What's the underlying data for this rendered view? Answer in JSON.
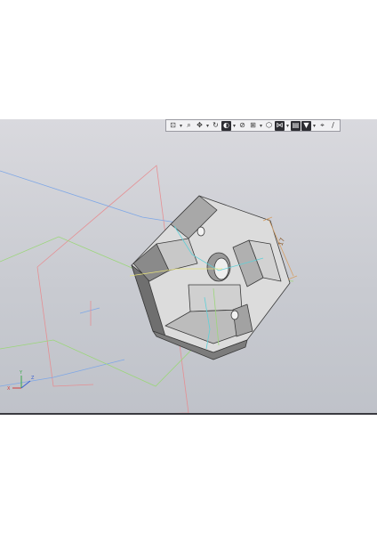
{
  "toolbar": {
    "buttons": [
      {
        "name": "view-orientation-button",
        "glyph": "⊡",
        "dark": false
      },
      {
        "name": "zoom-window-button",
        "glyph": "⌕",
        "dark": false
      },
      {
        "name": "pan-button",
        "glyph": "✥",
        "dark": false
      },
      {
        "name": "rotate-button",
        "glyph": "↻",
        "dark": false
      },
      {
        "name": "display-style-button",
        "glyph": "◐",
        "dark": true
      },
      {
        "name": "section-button",
        "glyph": "⊘",
        "dark": false
      },
      {
        "name": "grid-button",
        "glyph": "⊞",
        "dark": false
      },
      {
        "name": "perspective-button",
        "glyph": "⬡",
        "dark": false
      },
      {
        "name": "constraints-button",
        "glyph": "⋈",
        "dark": true
      },
      {
        "name": "layers-button",
        "glyph": "▤",
        "dark": true
      },
      {
        "name": "filter-button",
        "glyph": "▼",
        "dark": true
      },
      {
        "name": "snap-button",
        "glyph": "⌖",
        "dark": false
      },
      {
        "name": "measure-button",
        "glyph": "∕",
        "dark": false
      }
    ]
  },
  "dimension_label": "17",
  "axis_triad": {
    "x_label": "X",
    "y_label": "Y",
    "z_label": "Z"
  },
  "colors": {
    "viewport_top": "#d9d9de",
    "viewport_bottom": "#bfc2c9",
    "plane_red": "#e58f93",
    "plane_blue": "#7ea7e6",
    "plane_green": "#9bd67a",
    "part_light": "#dcdcdc",
    "part_mid": "#b4b4b4",
    "part_dark": "#6f6f6f",
    "edge": "#3a3a3a",
    "dimension": "#d6a066"
  }
}
